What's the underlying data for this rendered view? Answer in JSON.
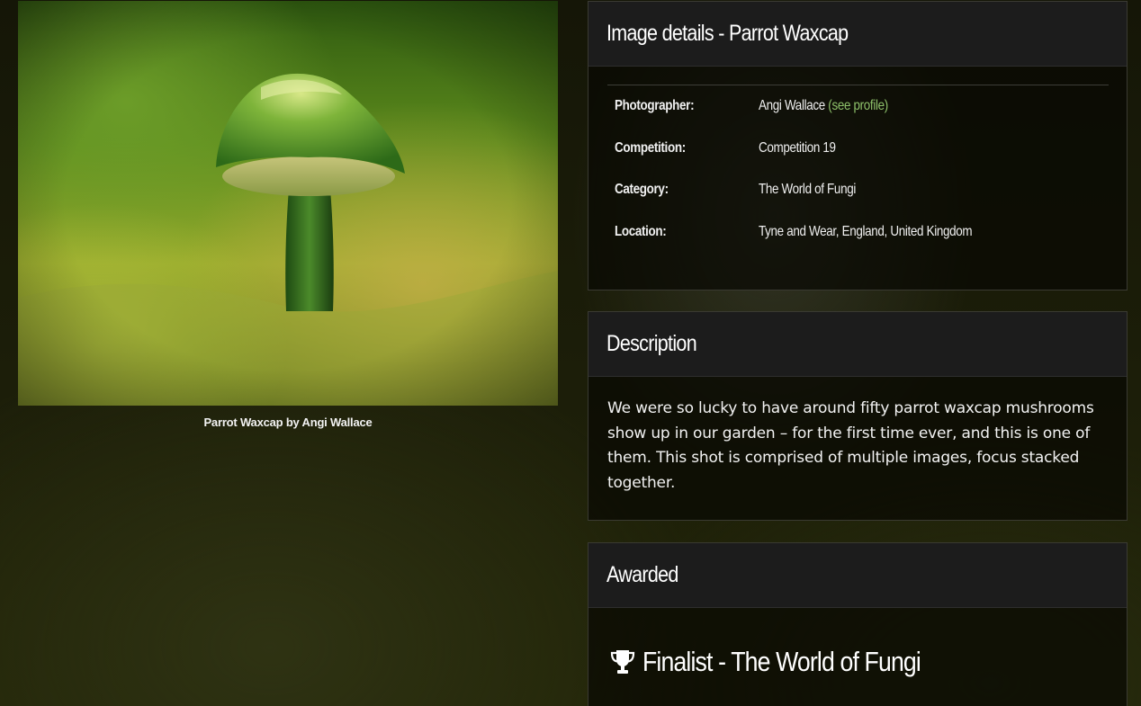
{
  "photo": {
    "caption": "Parrot Waxcap by Angi Wallace"
  },
  "details": {
    "title": "Image details - Parrot Waxcap",
    "rows": [
      {
        "label": "Photographer:",
        "value": "Angi Wallace",
        "link": "(see profile)"
      },
      {
        "label": "Competition:",
        "value": "Competition 19"
      },
      {
        "label": "Category:",
        "value": "The World of Fungi"
      },
      {
        "label": "Location:",
        "value": "Tyne and Wear, England, United Kingdom"
      }
    ]
  },
  "description": {
    "title": "Description",
    "text": "We were so lucky to have around fifty parrot waxcap mushrooms show up in our garden – for the first time ever, and this is one of them. This shot is comprised of multiple images, focus stacked together."
  },
  "awarded": {
    "title": "Awarded",
    "award": "Finalist - The World of Fungi",
    "icon": "trophy-icon"
  },
  "colors": {
    "link": "#8ec16a",
    "panel_header": "#1c1c1c"
  }
}
